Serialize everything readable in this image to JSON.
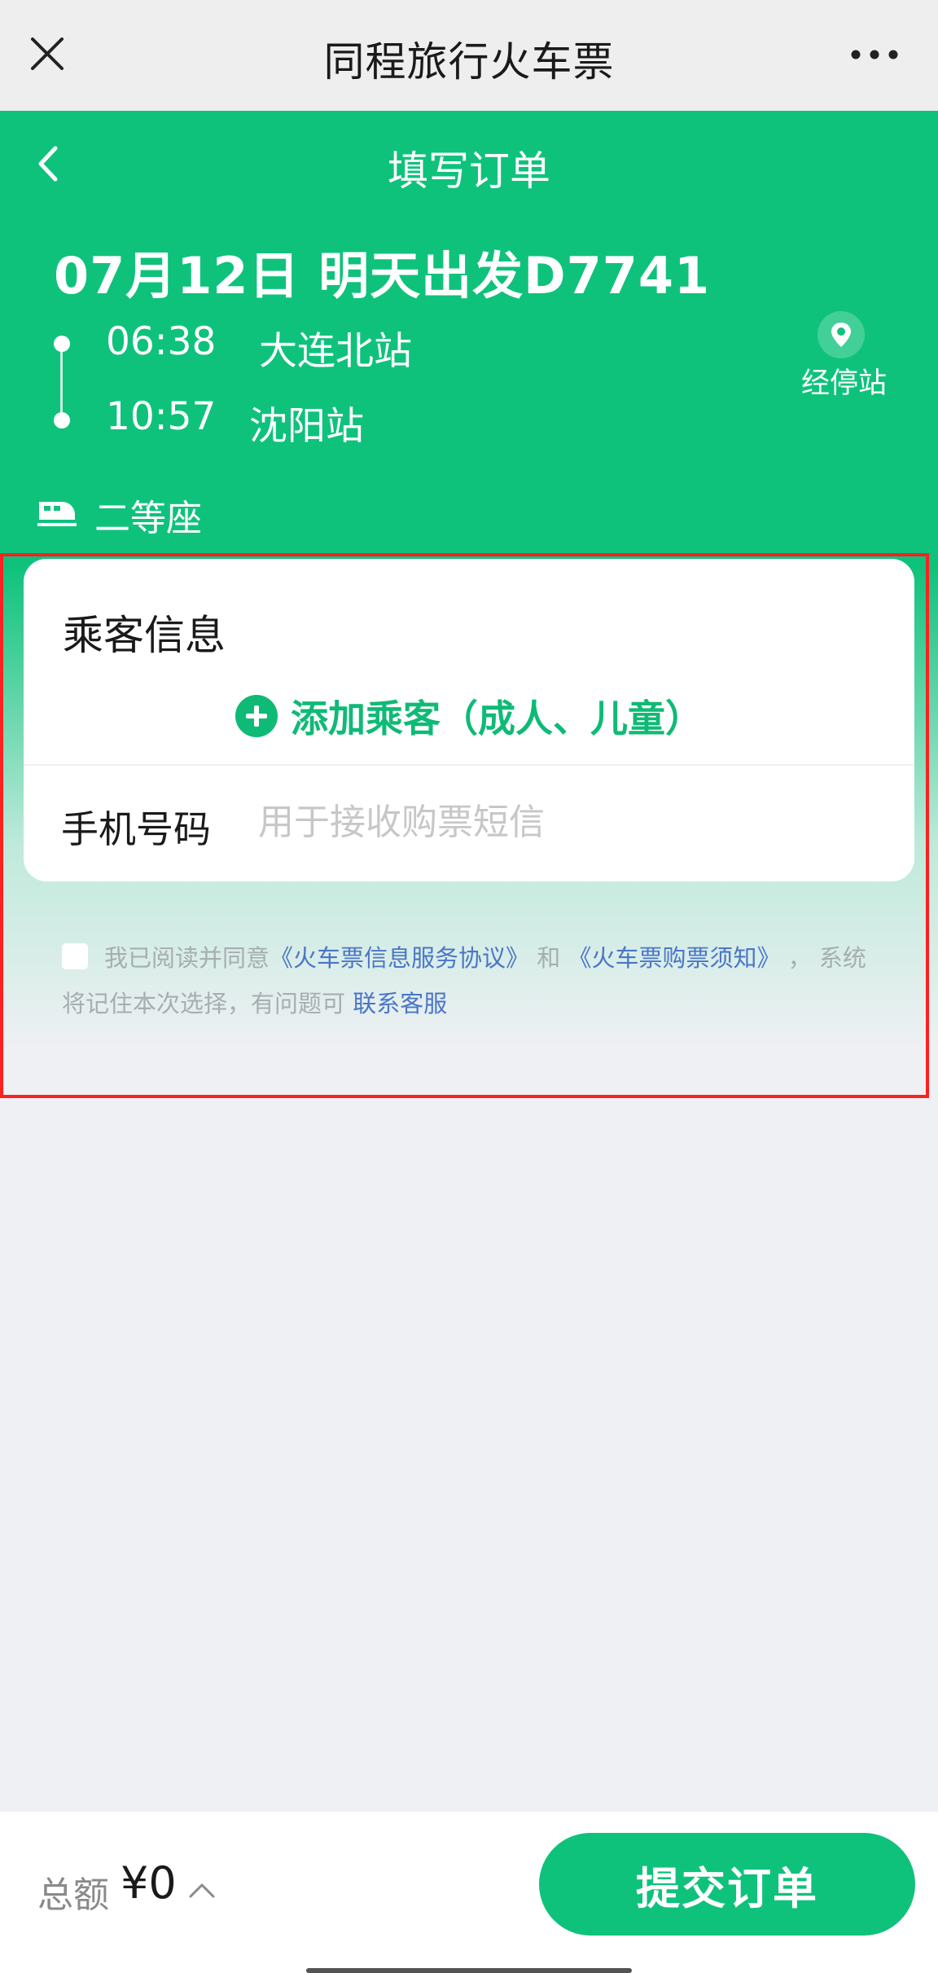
{
  "window": {
    "title": "同程旅行火车票",
    "close_icon": "close-icon",
    "more_icon": "more-dots-icon"
  },
  "header": {
    "page_title": "填写订单",
    "train_line": "07月12日 明天出发D7741",
    "departure": {
      "time": "06:38",
      "station": "大连北站"
    },
    "arrival": {
      "time": "10:57",
      "station": "沈阳站"
    },
    "stops_label": "经停站",
    "seat_type": "二等座",
    "accent_color": "#0fc27c"
  },
  "passenger": {
    "section_title": "乘客信息",
    "add_label": "添加乘客（成人、儿童）",
    "phone_label": "手机号码",
    "phone_value": "",
    "phone_placeholder": "用于接收购票短信"
  },
  "agreement": {
    "prefix": "我已阅读并同意",
    "link1": "《火车票信息服务协议》",
    "conj": " 和 ",
    "link2": "《火车票购票须知》",
    "middle": " ， 系统将记住本次选择，有问题可 ",
    "link3": "联系客服",
    "checked": false
  },
  "footer": {
    "total_label": "总额",
    "total_amount": "¥0",
    "submit_label": "提交订单"
  }
}
